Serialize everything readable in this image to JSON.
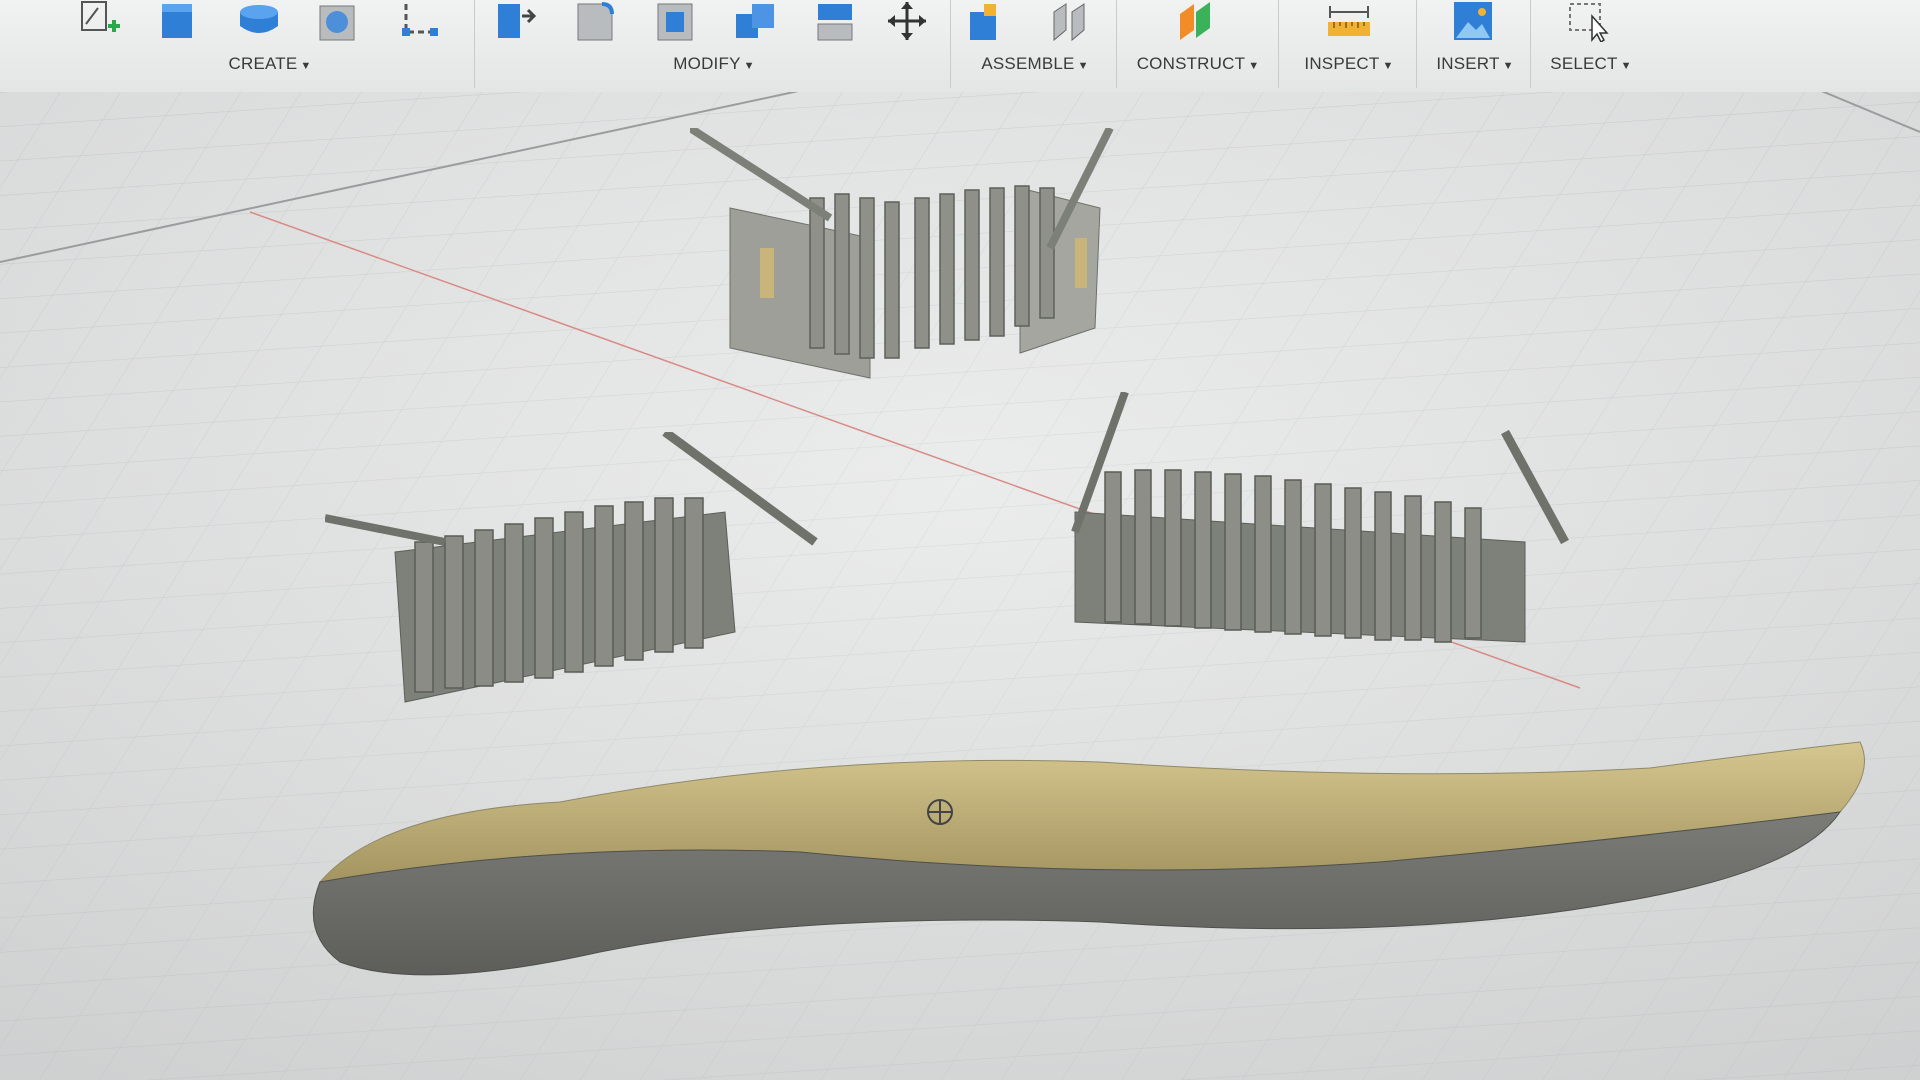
{
  "toolbar": {
    "groups": [
      {
        "label": "CREATE"
      },
      {
        "label": "MODIFY"
      },
      {
        "label": "ASSEMBLE"
      },
      {
        "label": "CONSTRUCT"
      },
      {
        "label": "INSPECT"
      },
      {
        "label": "INSERT"
      },
      {
        "label": "SELECT"
      }
    ],
    "caret": "▼"
  },
  "icons": {
    "create": [
      "sketch-plus-icon",
      "extrude-box-icon",
      "revolve-icon",
      "hole-icon",
      "line-dimension-icon"
    ],
    "modify": [
      "press-pull-icon",
      "fillet-icon",
      "shell-icon",
      "combine-icon",
      "split-icon",
      "move-icon"
    ],
    "assemble": [
      "new-component-icon",
      "joint-icon"
    ],
    "construct": [
      "offset-plane-icon"
    ],
    "inspect": [
      "measure-icon"
    ],
    "insert": [
      "insert-image-icon"
    ],
    "select": [
      "select-window-icon"
    ]
  },
  "colors": {
    "viewport_bg": "#e6e7e7",
    "grid_line": "#c9cbcc",
    "x_axis": "#d98a85",
    "body_gray": "#8d8f88",
    "insole_top": "#c9b57a",
    "insole_side": "#6f706c"
  }
}
